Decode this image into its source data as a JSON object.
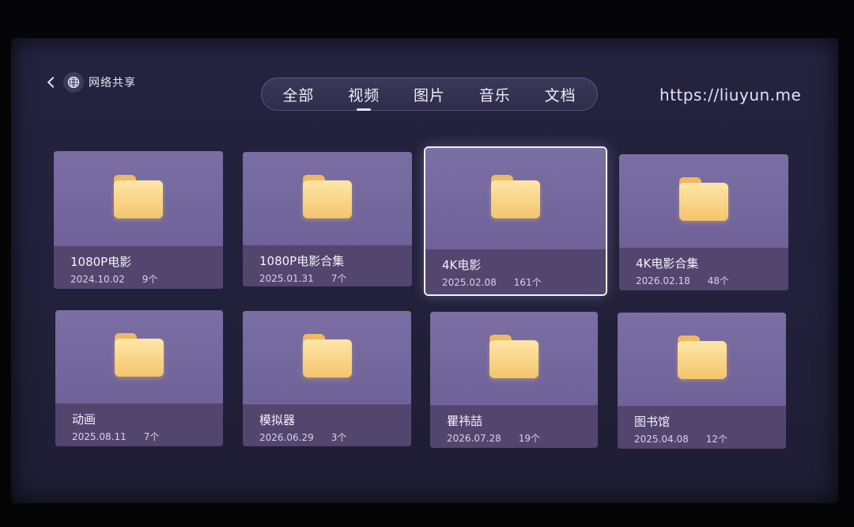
{
  "header": {
    "back_label": "网络共享",
    "url": "https://liuyun.me"
  },
  "tabs": [
    {
      "label": "全部",
      "active": false
    },
    {
      "label": "视频",
      "active": true
    },
    {
      "label": "图片",
      "active": false
    },
    {
      "label": "音乐",
      "active": false
    },
    {
      "label": "文档",
      "active": false
    }
  ],
  "folders": [
    {
      "name": "1080P电影",
      "date": "2024.10.02",
      "count": "9个",
      "focused": false
    },
    {
      "name": "1080P电影合集",
      "date": "2025.01.31",
      "count": "7个",
      "focused": false
    },
    {
      "name": "4K电影",
      "date": "2025.02.08",
      "count": "161个",
      "focused": true
    },
    {
      "name": "4K电影合集",
      "date": "2026.02.18",
      "count": "48个",
      "focused": false
    },
    {
      "name": "动画",
      "date": "2025.08.11",
      "count": "7个",
      "focused": false
    },
    {
      "name": "模拟器",
      "date": "2026.06.29",
      "count": "3个",
      "focused": false
    },
    {
      "name": "瞿祎喆",
      "date": "2026.07.28",
      "count": "19个",
      "focused": false
    },
    {
      "name": "图书馆",
      "date": "2025.04.08",
      "count": "12个",
      "focused": false
    }
  ],
  "icons": {
    "back": "chevron-left-icon",
    "network": "globe-icon",
    "folder": "folder-icon"
  },
  "colors": {
    "folder": "#f8d283",
    "card": "#7a6ea3",
    "background": "#24233f"
  }
}
